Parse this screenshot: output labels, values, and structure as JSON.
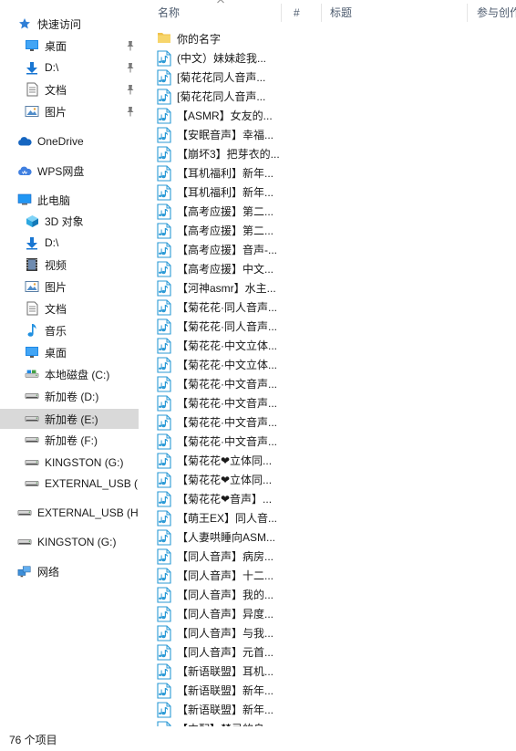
{
  "nav": {
    "items": [
      {
        "label": "快速访问",
        "icon": "star-icon",
        "indent": 0,
        "pinned": false,
        "selected": false
      },
      {
        "label": "桌面",
        "icon": "desktop-icon",
        "indent": 1,
        "pinned": true,
        "selected": false
      },
      {
        "label": "D:\\",
        "icon": "download-arrow-icon",
        "indent": 1,
        "pinned": true,
        "selected": false
      },
      {
        "label": "文档",
        "icon": "document-icon",
        "indent": 1,
        "pinned": true,
        "selected": false
      },
      {
        "label": "图片",
        "icon": "picture-icon",
        "indent": 1,
        "pinned": true,
        "selected": false
      },
      {
        "label": "OneDrive",
        "icon": "cloud-icon",
        "indent": 0,
        "pinned": false,
        "selected": false
      },
      {
        "label": "WPS网盘",
        "icon": "wps-cloud-icon",
        "indent": 0,
        "pinned": false,
        "selected": false
      },
      {
        "label": "此电脑",
        "icon": "computer-icon",
        "indent": 0,
        "pinned": false,
        "selected": false
      },
      {
        "label": "3D 对象",
        "icon": "cube-3d-icon",
        "indent": 1,
        "pinned": false,
        "selected": false
      },
      {
        "label": "D:\\",
        "icon": "download-arrow-icon",
        "indent": 1,
        "pinned": false,
        "selected": false
      },
      {
        "label": "视频",
        "icon": "video-icon",
        "indent": 1,
        "pinned": false,
        "selected": false
      },
      {
        "label": "图片",
        "icon": "picture-icon",
        "indent": 1,
        "pinned": false,
        "selected": false
      },
      {
        "label": "文档",
        "icon": "document-icon",
        "indent": 1,
        "pinned": false,
        "selected": false
      },
      {
        "label": "音乐",
        "icon": "music-note-icon",
        "indent": 1,
        "pinned": false,
        "selected": false
      },
      {
        "label": "桌面",
        "icon": "desktop-icon",
        "indent": 1,
        "pinned": false,
        "selected": false
      },
      {
        "label": "本地磁盘 (C:)",
        "icon": "local-disk-icon",
        "indent": 1,
        "pinned": false,
        "selected": false
      },
      {
        "label": "新加卷 (D:)",
        "icon": "drive-icon",
        "indent": 1,
        "pinned": false,
        "selected": false
      },
      {
        "label": "新加卷 (E:)",
        "icon": "drive-icon",
        "indent": 1,
        "pinned": false,
        "selected": true
      },
      {
        "label": "新加卷 (F:)",
        "icon": "drive-icon",
        "indent": 1,
        "pinned": false,
        "selected": false
      },
      {
        "label": "KINGSTON (G:)",
        "icon": "usb-drive-icon",
        "indent": 1,
        "pinned": false,
        "selected": false
      },
      {
        "label": "EXTERNAL_USB (H:)",
        "icon": "usb-drive-icon",
        "indent": 1,
        "pinned": false,
        "selected": false
      },
      {
        "label": "EXTERNAL_USB (H:)",
        "icon": "usb-drive-icon",
        "indent": 0,
        "pinned": false,
        "selected": false
      },
      {
        "label": "KINGSTON (G:)",
        "icon": "usb-drive-icon",
        "indent": 0,
        "pinned": false,
        "selected": false
      },
      {
        "label": "网络",
        "icon": "network-icon",
        "indent": 0,
        "pinned": false,
        "selected": false
      }
    ]
  },
  "header": {
    "name": "名称",
    "number": "#",
    "title": "标题",
    "artist": "参与创作"
  },
  "files": [
    {
      "name": "你的名字",
      "type": "folder"
    },
    {
      "name": "(中文）妹妹趁我...",
      "type": "audio"
    },
    {
      "name": "[菊花花同人音声...",
      "type": "audio"
    },
    {
      "name": "[菊花花同人音声...",
      "type": "audio"
    },
    {
      "name": "【ASMR】女友的...",
      "type": "audio"
    },
    {
      "name": "【安眠音声】幸福...",
      "type": "audio"
    },
    {
      "name": "【崩坏3】把芽衣的...",
      "type": "audio"
    },
    {
      "name": "【耳机福利】新年...",
      "type": "audio"
    },
    {
      "name": "【耳机福利】新年...",
      "type": "audio"
    },
    {
      "name": "【高考应援】第二...",
      "type": "audio"
    },
    {
      "name": "【高考应援】第二...",
      "type": "audio"
    },
    {
      "name": "【高考应援】音声-...",
      "type": "audio"
    },
    {
      "name": "【高考应援】中文...",
      "type": "audio"
    },
    {
      "name": "【河神asmr】水主...",
      "type": "audio"
    },
    {
      "name": "【菊花花·同人音声...",
      "type": "audio"
    },
    {
      "name": "【菊花花·同人音声...",
      "type": "audio"
    },
    {
      "name": "【菊花花·中文立体...",
      "type": "audio"
    },
    {
      "name": "【菊花花·中文立体...",
      "type": "audio"
    },
    {
      "name": "【菊花花·中文音声...",
      "type": "audio"
    },
    {
      "name": "【菊花花·中文音声...",
      "type": "audio"
    },
    {
      "name": "【菊花花·中文音声...",
      "type": "audio"
    },
    {
      "name": "【菊花花·中文音声...",
      "type": "audio"
    },
    {
      "name": "【菊花花❤立体同...",
      "type": "audio"
    },
    {
      "name": "【菊花花❤立体同...",
      "type": "audio"
    },
    {
      "name": "【菊花花❤音声】...",
      "type": "audio"
    },
    {
      "name": "【萌王EX】同人音...",
      "type": "audio"
    },
    {
      "name": "【人妻哄睡向ASM...",
      "type": "audio"
    },
    {
      "name": "【同人音声】病房...",
      "type": "audio"
    },
    {
      "name": "【同人音声】十二...",
      "type": "audio"
    },
    {
      "name": "【同人音声】我的...",
      "type": "audio"
    },
    {
      "name": "【同人音声】异度...",
      "type": "audio"
    },
    {
      "name": "【同人音声】与我...",
      "type": "audio"
    },
    {
      "name": "【同人音声】元首...",
      "type": "audio"
    },
    {
      "name": "【新语联盟】耳机...",
      "type": "audio"
    },
    {
      "name": "【新语联盟】新年...",
      "type": "audio"
    },
    {
      "name": "【新语联盟】新年...",
      "type": "audio"
    },
    {
      "name": "【中配】禁忌的息...",
      "type": "audio"
    }
  ],
  "status": {
    "item_count": "76 个项目"
  },
  "colors": {
    "selected_bg": "#d9d9d9",
    "header_text": "#4d5b6e",
    "audio_icon": "#2b9ad6",
    "folder_icon": "#f0c24c",
    "accent_blue": "#0b6cc7"
  }
}
